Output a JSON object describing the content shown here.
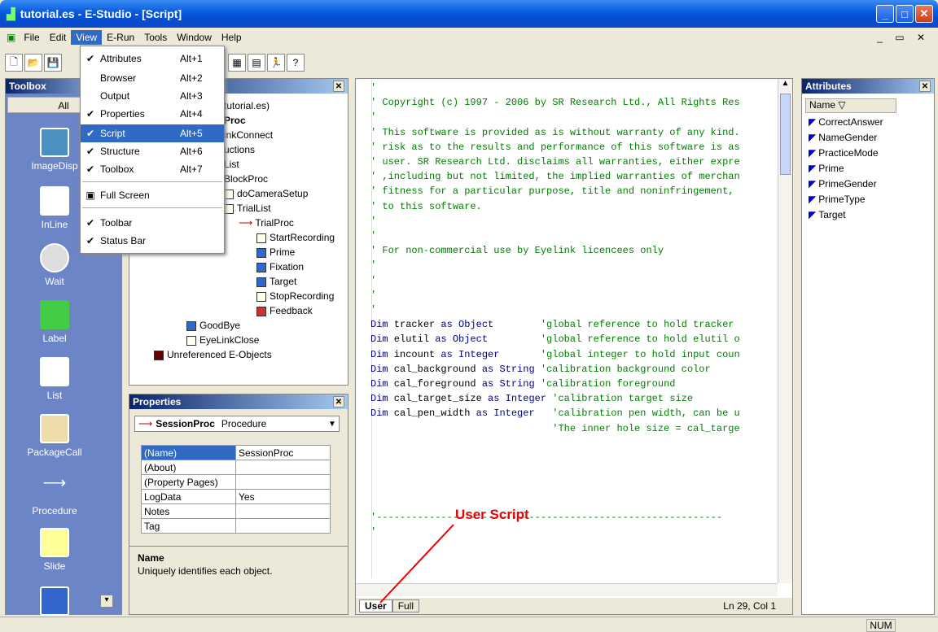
{
  "window": {
    "title": "tutorial.es - E-Studio - [Script]"
  },
  "menubar": {
    "items": [
      "File",
      "Edit",
      "View",
      "E-Run",
      "Tools",
      "Window",
      "Help"
    ]
  },
  "view_menu": {
    "items": [
      {
        "label": "Attributes",
        "shortcut": "Alt+1",
        "checked": true
      },
      {
        "label": "Browser",
        "shortcut": "Alt+2",
        "checked": false
      },
      {
        "label": "Output",
        "shortcut": "Alt+3",
        "checked": false
      },
      {
        "label": "Properties",
        "shortcut": "Alt+4",
        "checked": true
      },
      {
        "label": "Script",
        "shortcut": "Alt+5",
        "checked": true,
        "highlighted": true
      },
      {
        "label": "Structure",
        "shortcut": "Alt+6",
        "checked": true
      },
      {
        "label": "Toolbox",
        "shortcut": "Alt+7",
        "checked": true
      },
      {
        "label": "Full Screen",
        "shortcut": "",
        "checked": false
      },
      {
        "label": "Toolbar",
        "shortcut": "",
        "checked": true
      },
      {
        "label": "Status Bar",
        "shortcut": "",
        "checked": true
      }
    ]
  },
  "toolbox": {
    "title": "Toolbox",
    "filter": "All",
    "items": [
      "ImageDisp",
      "InLine",
      "Wait",
      "Label",
      "List",
      "PackageCall",
      "Procedure",
      "Slide"
    ]
  },
  "structure": {
    "nodes": [
      "tutorial.es)",
      "Proc",
      "inkConnect",
      "uctions",
      "List",
      "BlockProc",
      "doCameraSetup",
      "TrialList",
      "TrialProc",
      "StartRecording",
      "Prime",
      "Fixation",
      "Target",
      "StopRecording",
      "Feedback",
      "GoodBye",
      "EyeLinkClose",
      "Unreferenced E-Objects"
    ]
  },
  "properties": {
    "title": "Properties",
    "selector_name": "SessionProc",
    "selector_type": "Procedure",
    "rows": [
      {
        "key": "(Name)",
        "value": "SessionProc"
      },
      {
        "key": "(About)",
        "value": ""
      },
      {
        "key": "(Property Pages)",
        "value": ""
      },
      {
        "key": "LogData",
        "value": "Yes"
      },
      {
        "key": "Notes",
        "value": ""
      },
      {
        "key": "Tag",
        "value": ""
      }
    ],
    "help_title": "Name",
    "help_text": "Uniquely identifies each object."
  },
  "editor": {
    "lines": [
      "'",
      "' Copyright (c) 1997 - 2006 by SR Research Ltd., All Rights Res",
      "'",
      "' This software is provided as is without warranty of any kind.",
      "' risk as to the results and performance of this software is as",
      "' user. SR Research Ltd. disclaims all warranties, either expre",
      "' ,including but not limited, the implied warranties of merchan",
      "' fitness for a particular purpose, title and noninfringement,",
      "' to this software.",
      "'",
      "'",
      "' For non-commercial use by Eyelink licencees only",
      "'",
      "'",
      "'",
      "'"
    ],
    "dims": [
      {
        "kw": "Dim",
        "name": " tracker ",
        "as": "as",
        "type": "Object",
        "comment": "        'global reference to hold tracker"
      },
      {
        "kw": "Dim",
        "name": " elutil ",
        "as": "as",
        "type": "Object",
        "comment": "         'global reference to hold elutil o"
      },
      {
        "kw": "Dim",
        "name": " incount ",
        "as": "as",
        "type": "Integer",
        "comment": "       'global integer to hold input coun"
      },
      {
        "kw": "Dim",
        "name": " cal_background ",
        "as": "as",
        "type": "String",
        "comment": " 'calibration background color"
      },
      {
        "kw": "Dim",
        "name": " cal_foreground ",
        "as": "as",
        "type": "String",
        "comment": " 'calibration foreground"
      },
      {
        "kw": "Dim",
        "name": " cal_target_size ",
        "as": "as",
        "type": "Integer",
        "comment": " 'calibration target size"
      },
      {
        "kw": "Dim",
        "name": " cal_pen_width ",
        "as": "as",
        "type": "Integer",
        "comment": "   'calibration pen width, can be u"
      }
    ],
    "continuation": "                               'The inner hole size = cal_targe",
    "separator": "'-----------------------------------------------------------",
    "after_sep": "'",
    "annotation": "User Script",
    "tabs": [
      "User",
      "Full"
    ],
    "cursor": "Ln 29, Col 1"
  },
  "attributes": {
    "title": "Attributes",
    "column": "Name",
    "items": [
      "CorrectAnswer",
      "NameGender",
      "PracticeMode",
      "Prime",
      "PrimeGender",
      "PrimeType",
      "Target"
    ]
  },
  "statusbar": {
    "num": "NUM"
  }
}
